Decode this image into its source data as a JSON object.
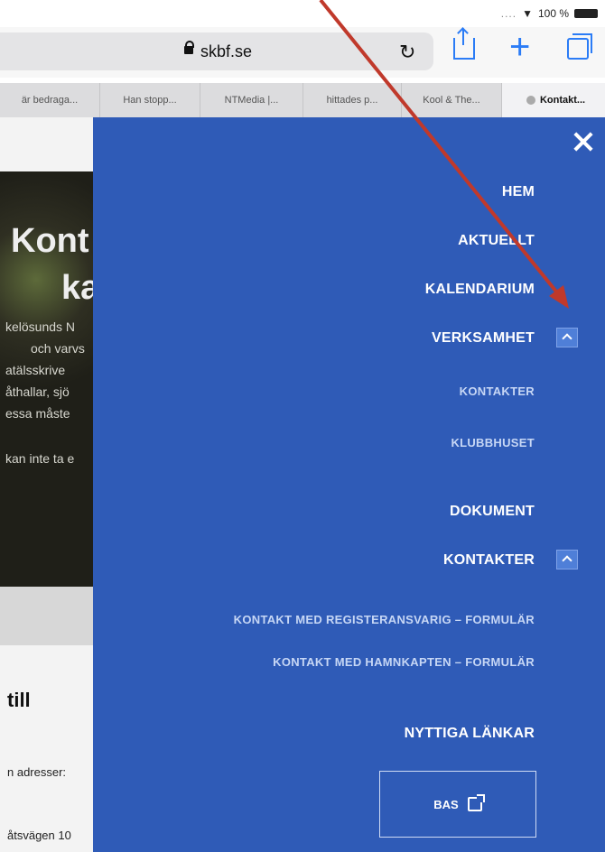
{
  "status": {
    "battery": "100 %"
  },
  "browser": {
    "url": "skbf.se",
    "tabs": [
      {
        "label": "är bedraga..."
      },
      {
        "label": "Han stopp..."
      },
      {
        "label": "NTMedia |..."
      },
      {
        "label": "hittades p..."
      },
      {
        "label": "Kool & The..."
      },
      {
        "label": "Kontakt..."
      }
    ]
  },
  "page": {
    "hero_title_1": "Kont",
    "hero_title_2": "ka",
    "hero_lines": [
      "kelösunds N",
      "och varvs",
      "atälsskrive",
      "åthallar, sjö",
      "essa måste",
      "kan inte ta e"
    ],
    "heading": "till",
    "text_1": "n adresser:",
    "text_2": "åtsvägen 10"
  },
  "nav": {
    "items": {
      "hem": "HEM",
      "aktuellt": "AKTUELLT",
      "kalendarium": "KALENDARIUM",
      "verksamhet": "VERKSAMHET",
      "verksamhet_sub": [
        "KONTAKTER",
        "KLUBBHUSET"
      ],
      "dokument": "DOKUMENT",
      "kontakter": "KONTAKTER",
      "kontakter_sub": [
        "KONTAKT MED REGISTERANSVARIG – FORMULÄR",
        "KONTAKT MED HAMNKAPTEN – FORMULÄR"
      ],
      "nyttiga": "NYTTIGA LÄNKAR"
    },
    "bas_button": "BAS"
  },
  "colors": {
    "nav_bg": "#2f5bb7",
    "accent": "#2b7cf6",
    "arrow": "#c0392b"
  }
}
